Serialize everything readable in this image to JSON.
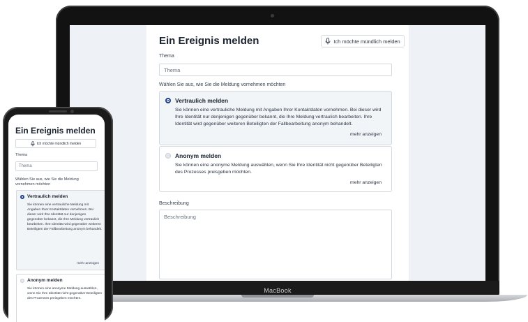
{
  "laptop": {
    "brand": "MacBook",
    "form": {
      "title": "Ein Ereignis melden",
      "talk_button": "Ich möchte mündlich melden",
      "topic_label": "Thema",
      "topic_placeholder": "Thema",
      "choose_label": "Wählen Sie aus, wie Sie die Meldung vornehmen möchten",
      "options": [
        {
          "title": "Vertraulich melden",
          "selected": true,
          "text": "Sie können eine vertrauliche Meldung mit Angaben Ihrer Kontaktdaten vornehmen. Bei dieser wird Ihre Identität nur denjenigen gegenüber bekannt, die Ihre Meldung vertraulich bearbeiten. Ihre Identität wird gegenüber weiteren Beteiligten der Fallbearbeitung anonym behandelt.",
          "more": "mehr anzeigen"
        },
        {
          "title": "Anonym melden",
          "selected": false,
          "text": "Sie können eine anonyme Meldung auswählen, wenn Sie Ihre Identität nicht gegenüber Beteiligten des Prozesses preisgeben möchten.",
          "more": "mehr anzeigen"
        }
      ],
      "description_label": "Beschreibung",
      "description_placeholder": "Beschreibung"
    }
  },
  "phone": {
    "title": "Ein Ereignis melden",
    "talk_button": "Ich möchte mündlich melden",
    "topic_label": "Thema",
    "topic_placeholder": "Thema",
    "choose_label_line1": "Wählen Sie aus, wie Sie die Meldung",
    "choose_label_line2": "vornehmen möchten",
    "options": [
      {
        "title": "Vertraulich melden",
        "selected": true,
        "text": "Sie können eine vertrauliche Meldung mit Angaben Ihrer Kontaktdaten vornehmen. Bei dieser wird Ihre Identität nur denjenigen gegenüber bekannt, die Ihre Meldung vertraulich bearbeiten. Ihre Identität wird gegenüber weiteren Beteiligten der Fallbearbeitung anonym behandelt.",
        "more": "mehr anzeigen"
      },
      {
        "title": "Anonym melden",
        "selected": false,
        "text": "Sie können eine anonyme Meldung auswählen, wenn Sie Ihre Identität nicht gegenüber Beteiligten des Prozesses preisgeben möchten."
      }
    ]
  },
  "colors": {
    "accent": "#1f3f8a",
    "screen_bg": "#eef1f5",
    "card_selected_bg": "#f2f5f8",
    "border": "#d4d9e0"
  },
  "icons": {
    "microphone": "microphone-icon"
  }
}
